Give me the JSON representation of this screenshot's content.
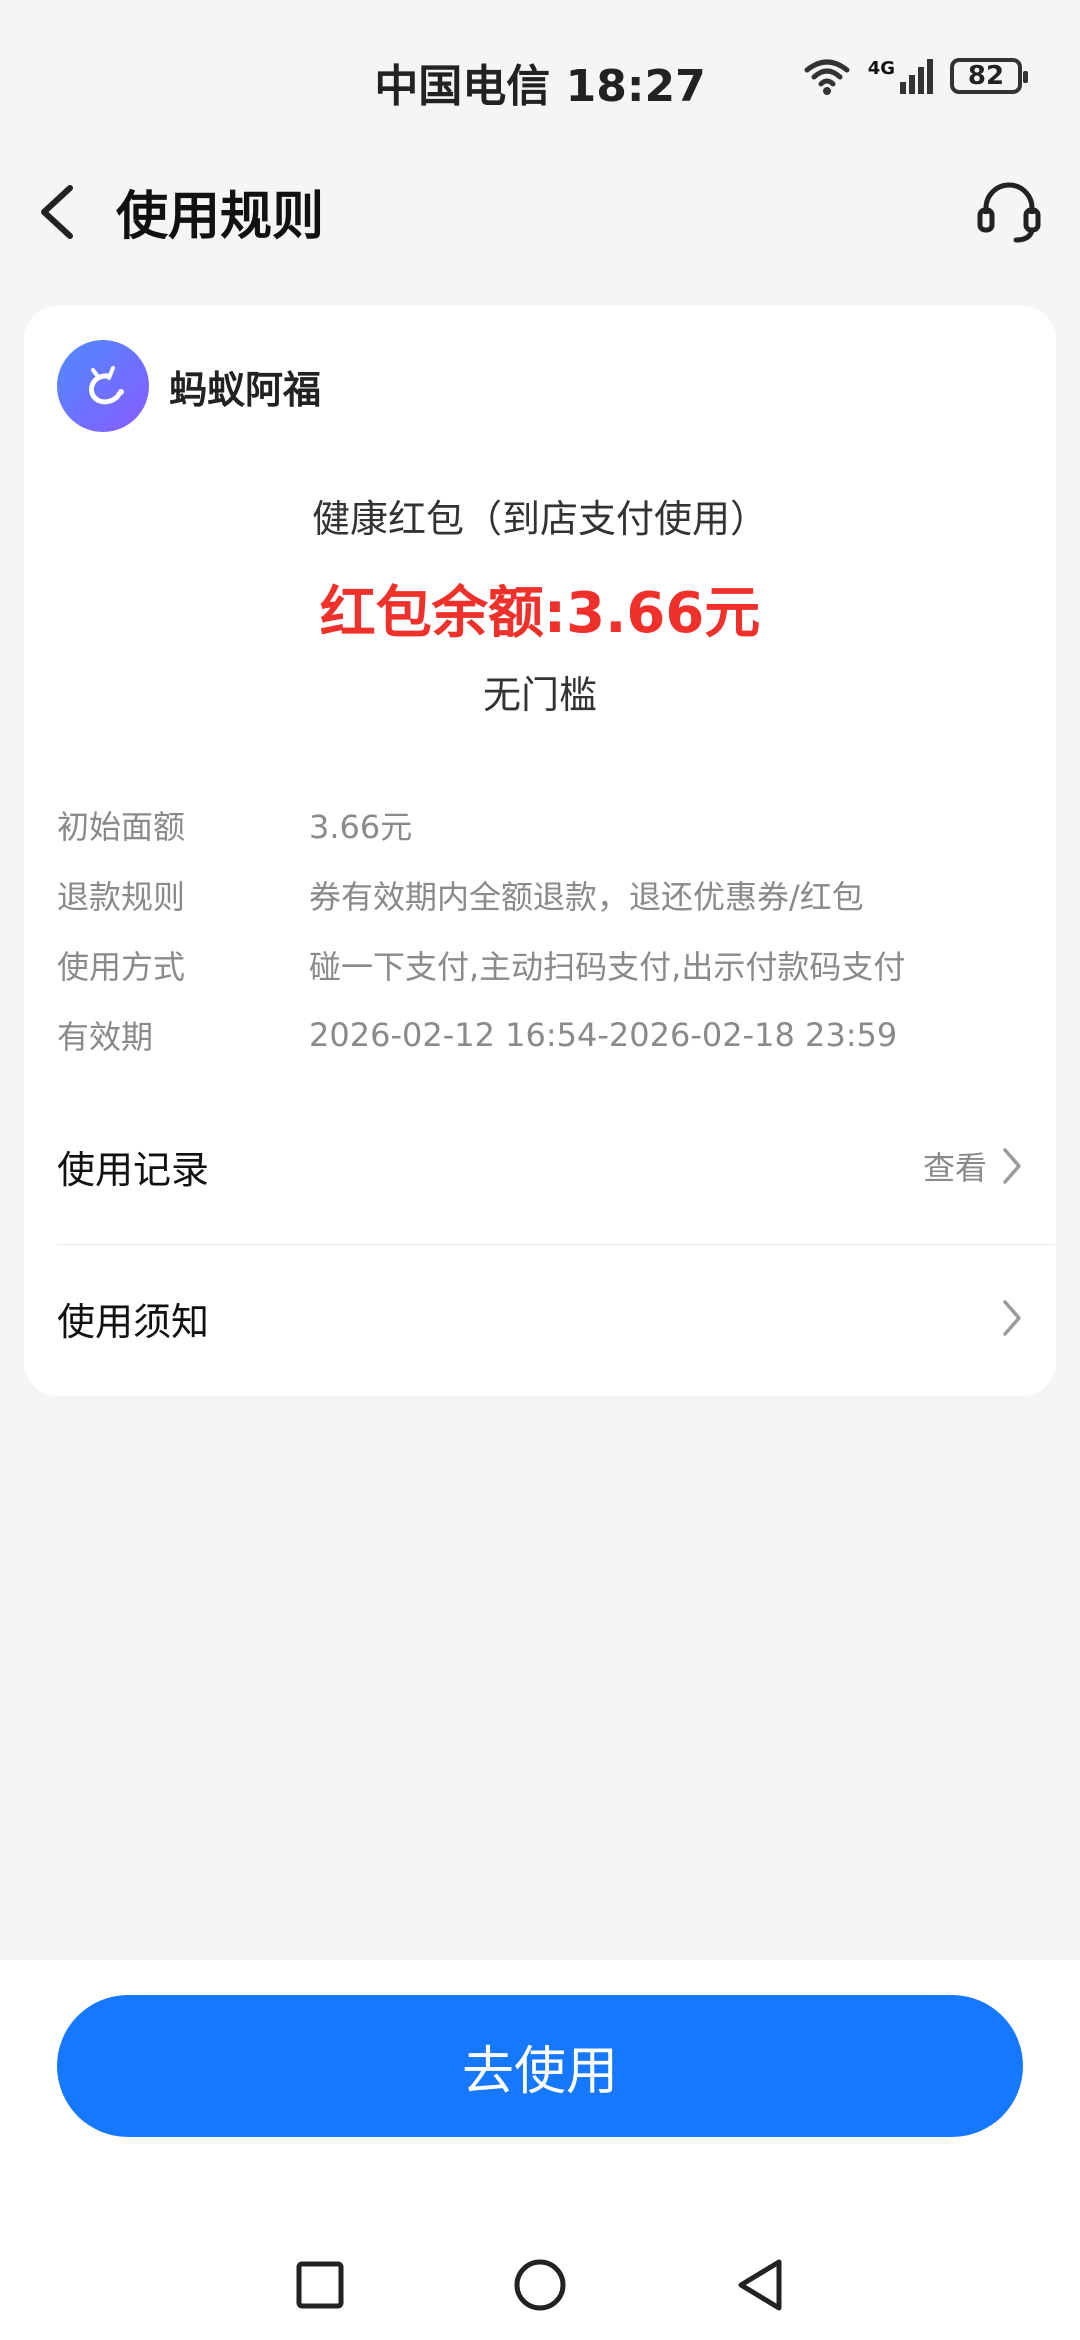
{
  "status_bar": {
    "carrier_time": "中国电信 18:27",
    "network": "4G",
    "battery": "82"
  },
  "header": {
    "title": "使用规则"
  },
  "card": {
    "brand_name": "蚂蚁阿福",
    "coupon_title": "健康红包（到店支付使用）",
    "balance_text": "红包余额:3.66元",
    "threshold_text": "无门槛",
    "info": [
      {
        "label": "初始面额",
        "value": "3.66元"
      },
      {
        "label": "退款规则",
        "value": "券有效期内全额退款，退还优惠券/红包"
      },
      {
        "label": "使用方式",
        "value": "碰一下支付,主动扫码支付,出示付款码支付"
      },
      {
        "label": "有效期",
        "value": "2026-02-12 16:54-2026-02-18 23:59"
      }
    ],
    "usage_record": {
      "title": "使用记录",
      "hint": "查看"
    },
    "usage_notice": {
      "title": "使用须知"
    }
  },
  "bottom": {
    "use_button_label": "去使用"
  },
  "colors": {
    "accent": "#1677ff",
    "balance_red": "#f0302a"
  }
}
